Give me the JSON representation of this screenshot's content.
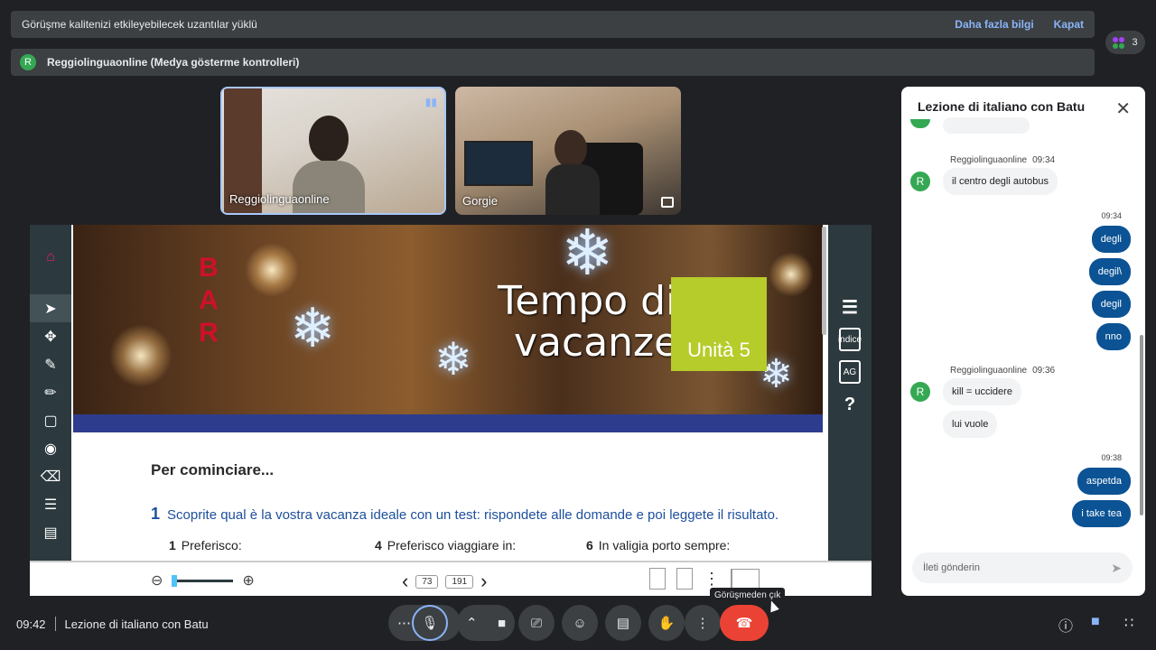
{
  "banner": {
    "message": "Görüşme kalitenizi etkileyebilecek uzantılar yüklü",
    "more_info": "Daha fazla bilgi",
    "close": "Kapat"
  },
  "presenting_banner": {
    "avatar_letter": "R",
    "text": "Reggiolinguaonline (Medya gösterme kontrolleri)"
  },
  "people_count": "3",
  "participants": [
    {
      "name": "Reggiolinguaonline"
    },
    {
      "name": "Gorgie"
    }
  ],
  "book": {
    "bar_letters": [
      "B",
      "A",
      "R"
    ],
    "title_line1": "Tempo di",
    "title_line2": "vacanze",
    "unit": "Unità 5",
    "section_title": "Per cominciare...",
    "exercise_number": "1",
    "exercise_text": "Scoprite qual è la vostra vacanza ideale con un test: rispondete alle domande e poi leggete il risultato.",
    "options": [
      {
        "num": "1",
        "text": "Preferisco:"
      },
      {
        "num": "4",
        "text": "Preferisco viaggiare in:"
      },
      {
        "num": "6",
        "text": "In valigia porto sempre:"
      }
    ]
  },
  "viewer": {
    "current_page": "73",
    "total_pages": "191",
    "right_tools": {
      "index": "indice",
      "ag": "AG",
      "help": "?"
    }
  },
  "chat": {
    "title": "Lezione di italiano con Batu",
    "messages": [
      {
        "sender": "Reggiolinguaonline",
        "time": "09:34",
        "avatar": "R",
        "text": "il centro degli autobus"
      },
      {
        "time": "09:34",
        "out": [
          "degli",
          "degil\\",
          "degil",
          "nno"
        ]
      },
      {
        "sender": "Reggiolinguaonline",
        "time": "09:36",
        "avatar": "R",
        "texts": [
          "kill = uccidere",
          "lui vuole"
        ]
      },
      {
        "time": "09:38",
        "out": [
          "aspetda",
          "i take tea"
        ]
      }
    ],
    "compose_placeholder": "İleti gönderin"
  },
  "footer": {
    "time": "09:42",
    "meeting_title": "Lezione di italiano con Batu",
    "leave_tooltip": "Görüşmeden çık"
  },
  "colors": {
    "accent": "#8ab4f8",
    "end_call": "#ea4335",
    "avatar": "#34a853",
    "unit_badge": "#b6cc2a"
  }
}
